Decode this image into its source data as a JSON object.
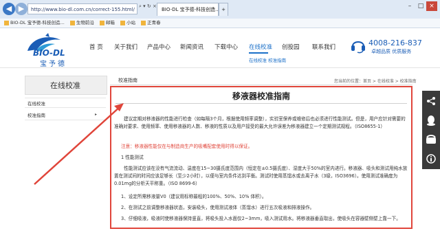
{
  "browser": {
    "address": "http://www.bio-dl.com.cn/correct-155.html/",
    "address_controls": "⌕ ▾ ↻ ×",
    "tab_title": "BIO-DL 宝予德-科技创造...",
    "new_tab": "+",
    "window_controls": [
      "–",
      "□",
      "×"
    ]
  },
  "favorites": [
    {
      "label": "BIO-DL 宝予德-科技创造..."
    },
    {
      "label": "生物前沿"
    },
    {
      "label": "邮箱"
    },
    {
      "label": "小站"
    },
    {
      "label": "正青春"
    }
  ],
  "site": {
    "logo_text": "BIO-DL",
    "logo_sub": "宝予德",
    "nav": [
      "首 页",
      "关于我们",
      "产品中心",
      "新闻资讯",
      "下载中心",
      "在线校准",
      "创投园",
      "联系我们"
    ],
    "subnav": "在线校准    校准指南",
    "phone": "4008-216-837",
    "slogan": "卓越品质  优质服务"
  },
  "sidebar": {
    "title": "在线校准",
    "items": [
      {
        "label": "在线校准"
      },
      {
        "label": "校准指南",
        "arrow": "▸"
      }
    ]
  },
  "content": {
    "section_title": "校准指南",
    "breadcrumb": "您当前的位置：首页 > 在线校准 > 校准指南",
    "article_title": "移液器校准指南",
    "p1": "建议定期对移液器的性能进行检查（如每隔3个月，根据使用频率调整），实验室保养或维修后也必须进行性能测试。但是，用户应针对需要的准确对要求、使用频率、使用移液器的人数、移液的性质以及用户接受的最大允许误差为移液器建立一个定期测试规程。（ISO8655-1）",
    "note": "注意：移液器性能仅在与制造商生产的吸嘴配套使用时得以保证。",
    "h1": "1 性能测试",
    "p2": "性能测试应该在没有气流流动、温度在15~30摄氏度范围内（恒定在±0.5摄氏度）、湿度大于50%的室内进行。移液器、吸头和测试用纯水放置在测试间的时间应该足够长（至少2小时），以便与室内条件达到平衡。测试时使用蒸馏水或去离子水（3级，ISO3696）。使用测试准确度为0.01mg的分析天平称重。（ISO 8699-6）",
    "s1": "1、设定所需移液量V0（建议用标称最程的100%、50%、10% 体积）。",
    "s2": "2、在测试之前调整移液器状态，安装吸头，使用测试液体（蒸馏水）进行五次吸液和排液操作。",
    "s3": "3、仔细吸液，吸液时使移液器保持竖直，将吸头投入水面仅2~3mm，吸入测试用水。将移液器垂直取出，使吸头在容器壁侧壁上靠一下。"
  },
  "float_toolbar": [
    "share-icon",
    "qq-icon",
    "phone-icon",
    "info-icon"
  ]
}
